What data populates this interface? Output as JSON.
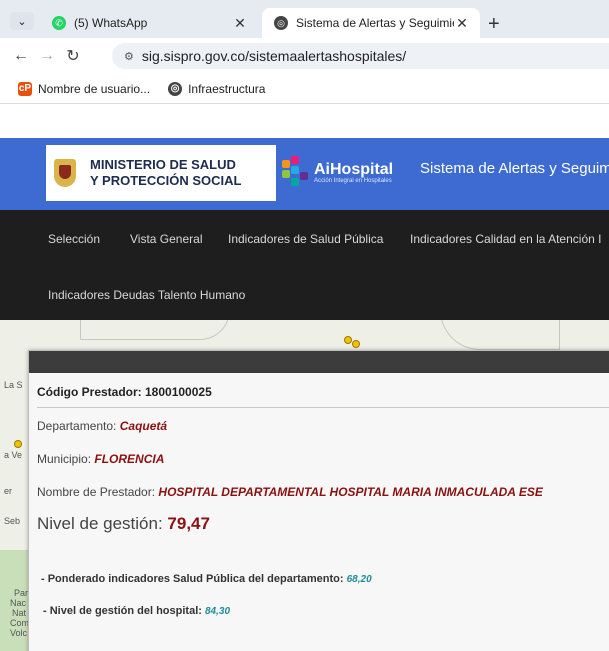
{
  "browser": {
    "tabs": [
      {
        "title": "(5) WhatsApp",
        "active": false,
        "icon": "whatsapp-icon"
      },
      {
        "title": "Sistema de Alertas y Seguimien",
        "active": true,
        "icon": "globe-icon"
      }
    ],
    "url": "sig.sispro.gov.co/sistemaalertashospitales/",
    "bookmarks": [
      {
        "label": "Nombre de usuario...",
        "icon": "cp-icon"
      },
      {
        "label": "Infraestructura",
        "icon": "globe-icon"
      }
    ]
  },
  "header": {
    "ministry_line1": "MINISTERIO DE SALUD",
    "ministry_line2": "Y PROTECCIÓN SOCIAL",
    "brand_name": "AiHospital",
    "brand_tagline": "Acción Integral en Hospitales",
    "system_title": "Sistema de Alertas y Seguimie",
    "accent_color": "#3d6bd2"
  },
  "nav": {
    "items": [
      "Selección",
      "Vista General",
      "Indicadores de Salud Pública",
      "Indicadores Calidad en la Atención I",
      "Indicadores Deudas Talento Humano"
    ]
  },
  "map": {
    "labels": [
      "La S",
      "a Ve",
      "er",
      "Seb",
      "Par",
      "Nac",
      "Nat",
      "Com",
      "Volc"
    ]
  },
  "panel": {
    "codigo_label": "Código Prestador: 1800100025",
    "departamento_label": "Departamento:",
    "departamento_value": "Caquetá",
    "municipio_label": "Municipio:",
    "municipio_value": "FLORENCIA",
    "prestador_label": "Nombre de Prestador:",
    "prestador_value": "HOSPITAL DEPARTAMENTAL HOSPITAL MARIA INMACULADA ESE",
    "nivel_label": "Nivel de gestión:",
    "nivel_value": "79,47",
    "ponderado_label": "- Ponderado indicadores Salud Pública del departamento:",
    "ponderado_value": "68,20",
    "nivel_hospital_label": "- Nivel de gestión del hospital:",
    "nivel_hospital_value": "84,30"
  }
}
